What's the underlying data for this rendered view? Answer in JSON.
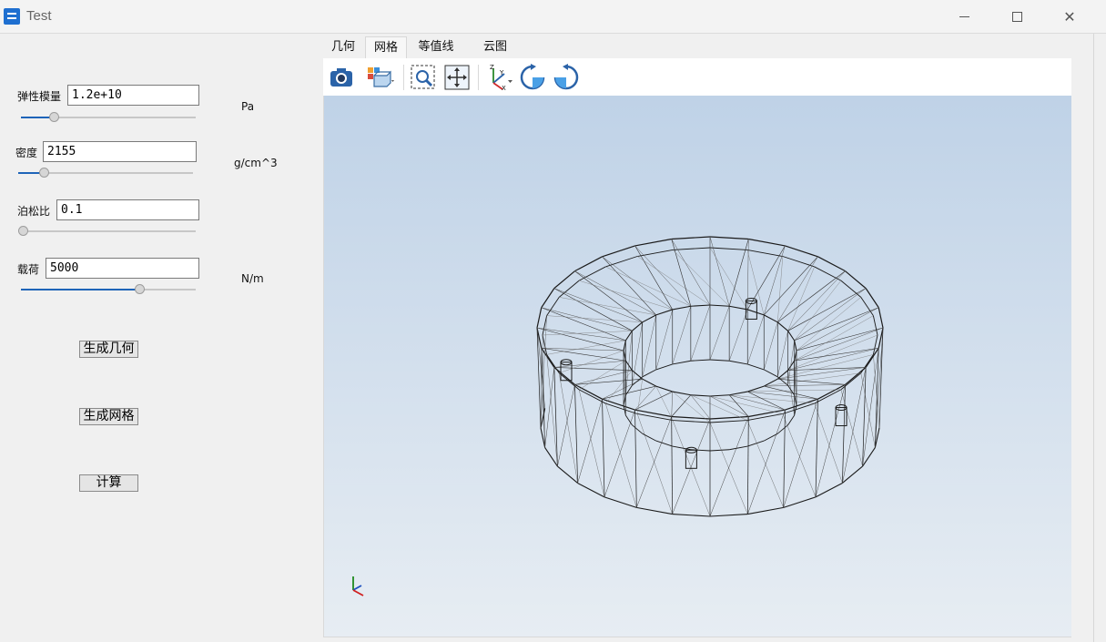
{
  "window": {
    "title": "Test"
  },
  "params": [
    {
      "label": "弹性模量",
      "value": "1.2e+10",
      "unit": "Pa",
      "slider_fraction": 0.2
    },
    {
      "label": "密度",
      "value": "2155",
      "unit": "g/cm^3",
      "slider_fraction": 0.15
    },
    {
      "label": "泊松比",
      "value": "0.1",
      "unit": "",
      "slider_fraction": 0.0
    },
    {
      "label": "载荷",
      "value": "5000",
      "unit": "N/m",
      "slider_fraction": 0.68
    }
  ],
  "buttons": {
    "geometry": "生成几何",
    "mesh": "生成网格",
    "compute": "计算"
  },
  "tabs": [
    {
      "label": "几何",
      "active": false
    },
    {
      "label": "网格",
      "active": true
    },
    {
      "label": "等值线",
      "active": false
    },
    {
      "label": "云图",
      "active": false
    }
  ],
  "toolbar": {
    "icons": [
      "camera-icon",
      "view-cube-icon",
      "zoom-fit-icon",
      "pan-fit-icon",
      "axis-orientation-icon",
      "rotate-cw-icon",
      "rotate-ccw-icon"
    ]
  },
  "axes_labels": {
    "x": "X",
    "y": "Y",
    "z": "Z"
  },
  "colors": {
    "slider_fill": "#1e64b8",
    "viewport_top": "#bfd2e7",
    "viewport_bottom": "#e7edf3",
    "accent_blue": "#1e6fd0"
  }
}
